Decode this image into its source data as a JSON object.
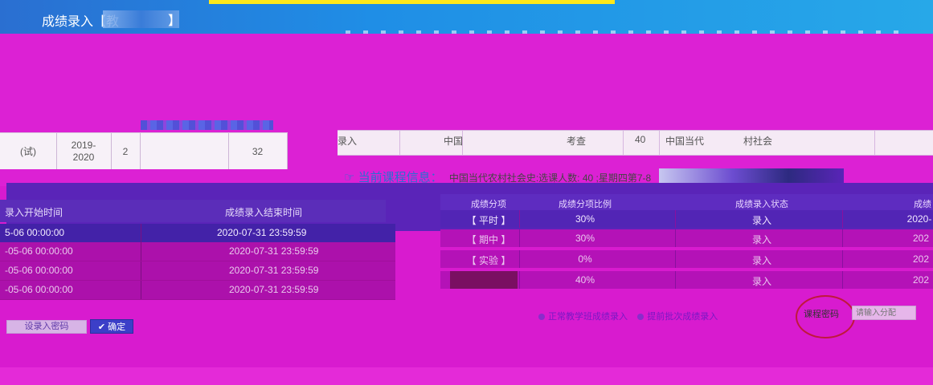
{
  "window": {
    "title": "成绩录入【教",
    "title_close": "】"
  },
  "course_row": {
    "year": "2019-\n2020",
    "term": "2",
    "hours": "32",
    "left_fragment": "(试)"
  },
  "right_row": {
    "cells": [
      "录入",
      "中国",
      "考查",
      "40",
      "中国当代",
      "村社会"
    ]
  },
  "current_course": {
    "label": "当前课程信息：",
    "value": "中国当代农村社会史:选课人数: 40 ;星期四第7-8"
  },
  "time_table": {
    "headers": [
      "录入开始时间",
      "成绩录入结束时间"
    ],
    "rows": [
      {
        "start": "5-06 00:00:00",
        "end": "2020-07-31 23:59:59"
      },
      {
        "start": "-05-06 00:00:00",
        "end": "2020-07-31 23:59:59"
      },
      {
        "start": "-05-06 00:00:00",
        "end": "2020-07-31 23:59:59"
      },
      {
        "start": "-05-06 00:00:00",
        "end": "2020-07-31 23:59:59"
      }
    ]
  },
  "grade_table": {
    "headers": [
      "成绩分项",
      "成绩分项比例",
      "成绩录入状态",
      "成绩"
    ],
    "rows": [
      {
        "item": "【 平时 】",
        "ratio": "30%",
        "status": "录入",
        "extra": "2020-"
      },
      {
        "item": "【 期中 】",
        "ratio": "30%",
        "status": "录入",
        "extra": "202"
      },
      {
        "item": "【 实验 】",
        "ratio": "0%",
        "status": "录入",
        "extra": "202"
      },
      {
        "item": "",
        "ratio": "40%",
        "status": "录入",
        "extra": "202"
      }
    ]
  },
  "entry_mode": {
    "option1": "正常教学班成绩录入",
    "option2": "提前批次成绩录入"
  },
  "password": {
    "label": "课程密码",
    "placeholder": "请输入分配"
  },
  "buttons": {
    "set_password": "设录入密码",
    "confirm": "确定",
    "confirm_icon": "check-icon"
  },
  "colors": {
    "header_blue": "#1f8ee6",
    "highlight_magenta": "#d81bcf",
    "confirm_blue": "#3c3fc8"
  }
}
